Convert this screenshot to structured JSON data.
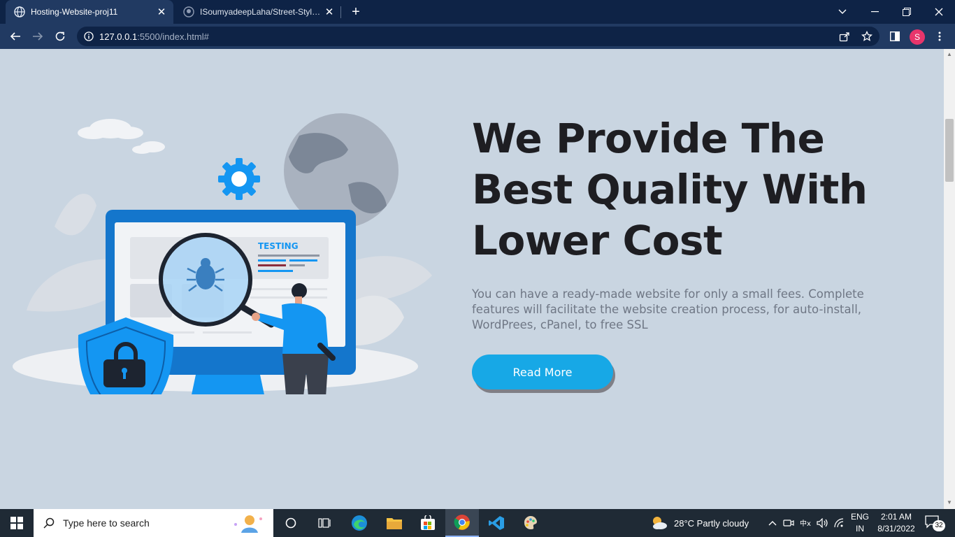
{
  "browser": {
    "tabs": [
      {
        "title": "Hosting-Website-proj11",
        "active": true,
        "icon": "globe-icon"
      },
      {
        "title": "ISoumyadeepLaha/Street-Style-L",
        "active": false,
        "icon": "github-icon"
      }
    ],
    "url_host": "127.0.0.1",
    "url_rest": ":5500/index.html#",
    "profile_initial": "S",
    "colors": {
      "frame": "#0e2346",
      "toolbar": "#213a62",
      "profile": "#e8356b"
    }
  },
  "page": {
    "hero": {
      "title_lines": [
        "We Provide The",
        "Best Quality With",
        "Lower Cost"
      ],
      "description": "You can have a ready-made website for only a small fees. Complete features will facilitate the website creation process, for auto-install, WordPrees, cPanel, to free SSL",
      "button_label": "Read More",
      "illustration_label": "TESTING"
    },
    "colors": {
      "background": "#c9d5e1",
      "accent": "#17a8e6",
      "heading": "#1e1e22",
      "text": "#6f7785"
    }
  },
  "taskbar": {
    "search_placeholder": "Type here to search",
    "pinned_apps": [
      "cortana-icon",
      "task-view-icon",
      "edge-icon",
      "file-explorer-icon",
      "store-icon",
      "chrome-icon",
      "vscode-icon",
      "paint-icon"
    ],
    "weather": "28°C  Partly cloudy",
    "language_line1": "ENG",
    "language_line2": "IN",
    "time": "2:01 AM",
    "date": "8/31/2022",
    "notification_count": "32"
  }
}
